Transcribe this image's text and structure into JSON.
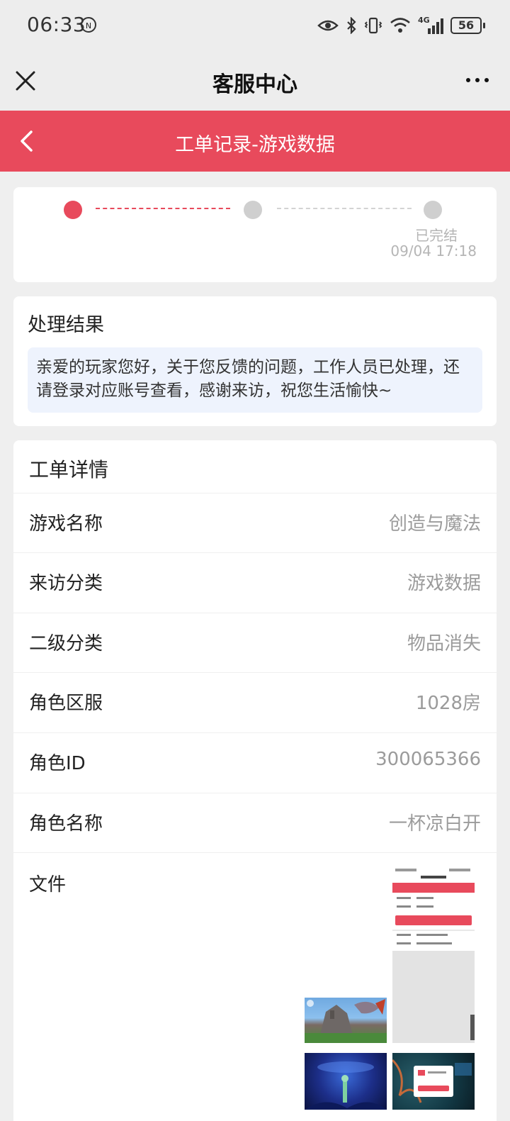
{
  "status_bar": {
    "time": "06:33",
    "time_badge": "N",
    "signal_label": "4G",
    "battery": "56"
  },
  "titlebar": {
    "title": "客服中心"
  },
  "header": {
    "title": "工单记录-游戏数据"
  },
  "progress": {
    "status_label": "已完结",
    "status_time": "09/04 17:18"
  },
  "result": {
    "title": "处理结果",
    "message": "亲爱的玩家您好，关于您反馈的问题，工作人员已处理，还请登录对应账号查看，感谢来访，祝您生活愉快~"
  },
  "details": {
    "title": "工单详情",
    "rows": [
      {
        "label": "游戏名称",
        "value": "创造与魔法"
      },
      {
        "label": "来访分类",
        "value": "游戏数据"
      },
      {
        "label": "二级分类",
        "value": "物品消失"
      },
      {
        "label": "角色区服",
        "value": "1028房"
      },
      {
        "label": "角色ID",
        "value": "300065366"
      },
      {
        "label": "角色名称",
        "value": "一杯凉白开"
      }
    ],
    "files_label": "文件"
  },
  "colors": {
    "accent": "#e84a5c",
    "background": "#efefef",
    "result_box": "#eef3fd"
  }
}
